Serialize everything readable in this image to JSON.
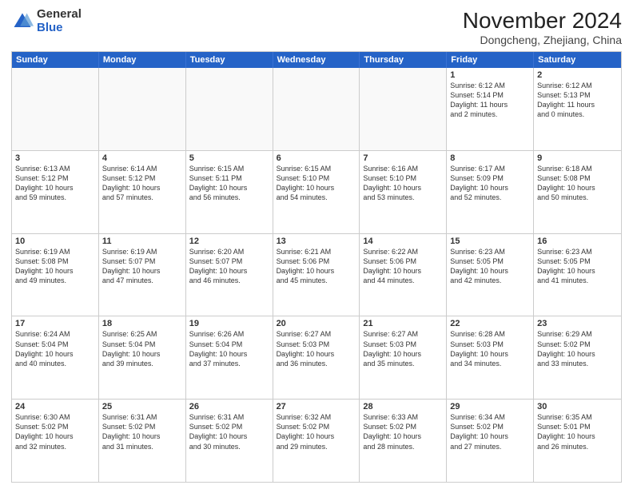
{
  "logo": {
    "general": "General",
    "blue": "Blue"
  },
  "title": "November 2024",
  "location": "Dongcheng, Zhejiang, China",
  "header_days": [
    "Sunday",
    "Monday",
    "Tuesday",
    "Wednesday",
    "Thursday",
    "Friday",
    "Saturday"
  ],
  "rows": [
    [
      {
        "day": "",
        "info": "",
        "empty": true
      },
      {
        "day": "",
        "info": "",
        "empty": true
      },
      {
        "day": "",
        "info": "",
        "empty": true
      },
      {
        "day": "",
        "info": "",
        "empty": true
      },
      {
        "day": "",
        "info": "",
        "empty": true
      },
      {
        "day": "1",
        "info": "Sunrise: 6:12 AM\nSunset: 5:14 PM\nDaylight: 11 hours\nand 2 minutes.",
        "empty": false
      },
      {
        "day": "2",
        "info": "Sunrise: 6:12 AM\nSunset: 5:13 PM\nDaylight: 11 hours\nand 0 minutes.",
        "empty": false
      }
    ],
    [
      {
        "day": "3",
        "info": "Sunrise: 6:13 AM\nSunset: 5:12 PM\nDaylight: 10 hours\nand 59 minutes.",
        "empty": false
      },
      {
        "day": "4",
        "info": "Sunrise: 6:14 AM\nSunset: 5:12 PM\nDaylight: 10 hours\nand 57 minutes.",
        "empty": false
      },
      {
        "day": "5",
        "info": "Sunrise: 6:15 AM\nSunset: 5:11 PM\nDaylight: 10 hours\nand 56 minutes.",
        "empty": false
      },
      {
        "day": "6",
        "info": "Sunrise: 6:15 AM\nSunset: 5:10 PM\nDaylight: 10 hours\nand 54 minutes.",
        "empty": false
      },
      {
        "day": "7",
        "info": "Sunrise: 6:16 AM\nSunset: 5:10 PM\nDaylight: 10 hours\nand 53 minutes.",
        "empty": false
      },
      {
        "day": "8",
        "info": "Sunrise: 6:17 AM\nSunset: 5:09 PM\nDaylight: 10 hours\nand 52 minutes.",
        "empty": false
      },
      {
        "day": "9",
        "info": "Sunrise: 6:18 AM\nSunset: 5:08 PM\nDaylight: 10 hours\nand 50 minutes.",
        "empty": false
      }
    ],
    [
      {
        "day": "10",
        "info": "Sunrise: 6:19 AM\nSunset: 5:08 PM\nDaylight: 10 hours\nand 49 minutes.",
        "empty": false
      },
      {
        "day": "11",
        "info": "Sunrise: 6:19 AM\nSunset: 5:07 PM\nDaylight: 10 hours\nand 47 minutes.",
        "empty": false
      },
      {
        "day": "12",
        "info": "Sunrise: 6:20 AM\nSunset: 5:07 PM\nDaylight: 10 hours\nand 46 minutes.",
        "empty": false
      },
      {
        "day": "13",
        "info": "Sunrise: 6:21 AM\nSunset: 5:06 PM\nDaylight: 10 hours\nand 45 minutes.",
        "empty": false
      },
      {
        "day": "14",
        "info": "Sunrise: 6:22 AM\nSunset: 5:06 PM\nDaylight: 10 hours\nand 44 minutes.",
        "empty": false
      },
      {
        "day": "15",
        "info": "Sunrise: 6:23 AM\nSunset: 5:05 PM\nDaylight: 10 hours\nand 42 minutes.",
        "empty": false
      },
      {
        "day": "16",
        "info": "Sunrise: 6:23 AM\nSunset: 5:05 PM\nDaylight: 10 hours\nand 41 minutes.",
        "empty": false
      }
    ],
    [
      {
        "day": "17",
        "info": "Sunrise: 6:24 AM\nSunset: 5:04 PM\nDaylight: 10 hours\nand 40 minutes.",
        "empty": false
      },
      {
        "day": "18",
        "info": "Sunrise: 6:25 AM\nSunset: 5:04 PM\nDaylight: 10 hours\nand 39 minutes.",
        "empty": false
      },
      {
        "day": "19",
        "info": "Sunrise: 6:26 AM\nSunset: 5:04 PM\nDaylight: 10 hours\nand 37 minutes.",
        "empty": false
      },
      {
        "day": "20",
        "info": "Sunrise: 6:27 AM\nSunset: 5:03 PM\nDaylight: 10 hours\nand 36 minutes.",
        "empty": false
      },
      {
        "day": "21",
        "info": "Sunrise: 6:27 AM\nSunset: 5:03 PM\nDaylight: 10 hours\nand 35 minutes.",
        "empty": false
      },
      {
        "day": "22",
        "info": "Sunrise: 6:28 AM\nSunset: 5:03 PM\nDaylight: 10 hours\nand 34 minutes.",
        "empty": false
      },
      {
        "day": "23",
        "info": "Sunrise: 6:29 AM\nSunset: 5:02 PM\nDaylight: 10 hours\nand 33 minutes.",
        "empty": false
      }
    ],
    [
      {
        "day": "24",
        "info": "Sunrise: 6:30 AM\nSunset: 5:02 PM\nDaylight: 10 hours\nand 32 minutes.",
        "empty": false
      },
      {
        "day": "25",
        "info": "Sunrise: 6:31 AM\nSunset: 5:02 PM\nDaylight: 10 hours\nand 31 minutes.",
        "empty": false
      },
      {
        "day": "26",
        "info": "Sunrise: 6:31 AM\nSunset: 5:02 PM\nDaylight: 10 hours\nand 30 minutes.",
        "empty": false
      },
      {
        "day": "27",
        "info": "Sunrise: 6:32 AM\nSunset: 5:02 PM\nDaylight: 10 hours\nand 29 minutes.",
        "empty": false
      },
      {
        "day": "28",
        "info": "Sunrise: 6:33 AM\nSunset: 5:02 PM\nDaylight: 10 hours\nand 28 minutes.",
        "empty": false
      },
      {
        "day": "29",
        "info": "Sunrise: 6:34 AM\nSunset: 5:02 PM\nDaylight: 10 hours\nand 27 minutes.",
        "empty": false
      },
      {
        "day": "30",
        "info": "Sunrise: 6:35 AM\nSunset: 5:01 PM\nDaylight: 10 hours\nand 26 minutes.",
        "empty": false
      }
    ]
  ]
}
